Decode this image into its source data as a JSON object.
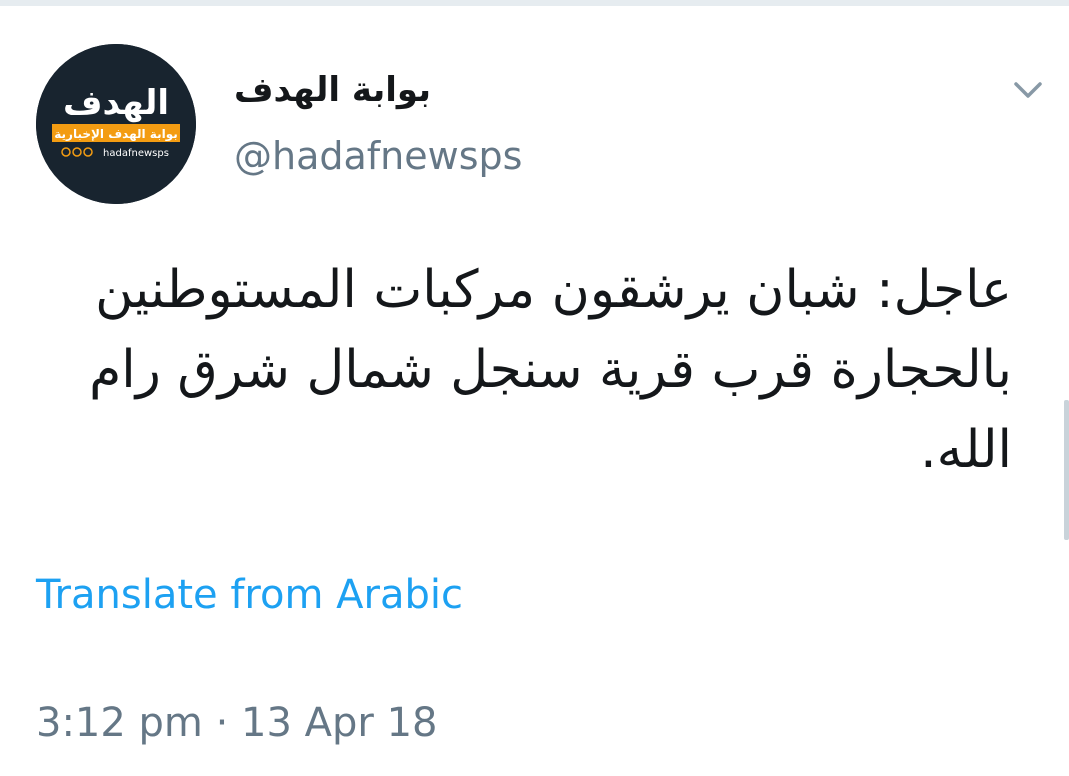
{
  "author": {
    "display_name": "بوابة الهدف",
    "handle": "@hadafnewsps",
    "avatar": {
      "logo_title": "الهدف",
      "logo_subtitle": "بوابة الهدف الإخبارية",
      "logo_social": "hadafnewsps",
      "background_color": "#18242f",
      "banner_color": "#f39c12"
    }
  },
  "tweet": {
    "text": "عاجل: شبان يرشقون مركبات المستوطنين بالحجارة قرب قرية سنجل شمال شرق رام الله.",
    "translate_label": "Translate from Arabic",
    "timestamp": "3:12 pm · 13 Apr 18"
  },
  "icons": {
    "menu": "chevron-down-icon"
  },
  "colors": {
    "link": "#1da1f2",
    "secondary_text": "#657786",
    "primary_text": "#14171a"
  }
}
